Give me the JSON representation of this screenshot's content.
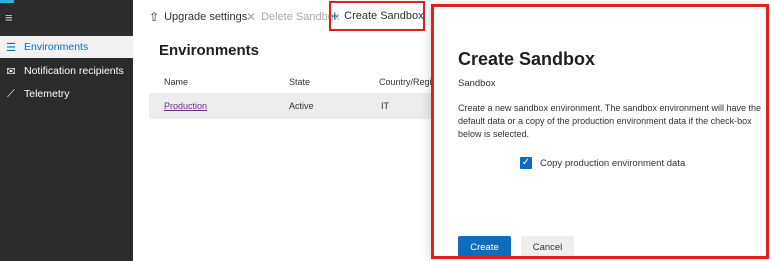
{
  "sidebar": {
    "items": [
      {
        "label": "Environments",
        "icon": "list-icon"
      },
      {
        "label": "Notification recipients",
        "icon": "mail-icon"
      },
      {
        "label": "Telemetry",
        "icon": "telemetry-icon"
      }
    ]
  },
  "toolbar": {
    "upgrade_label": "Upgrade settings",
    "delete_label": "Delete Sandbox",
    "create_label": "Create Sandbox"
  },
  "main": {
    "title": "Environments",
    "columns": [
      "Name",
      "State",
      "Country/Regio"
    ],
    "rows": [
      {
        "name": "Production",
        "state": "Active",
        "country": "IT"
      }
    ]
  },
  "panel": {
    "title": "Create Sandbox",
    "subtitle": "Sandbox",
    "description": "Create a new sandbox environment. The sandbox environment will have the default data or a copy of the production environment data if the check-box below is selected.",
    "checkbox_label": "Copy production environment data",
    "checkbox_checked": true,
    "create_label": "Create",
    "cancel_label": "Cancel"
  },
  "colors": {
    "accent": "#0f6cbd",
    "sidebar_bg": "#2b2b2b",
    "highlight": "#e02020",
    "link": "#6a2c91"
  }
}
